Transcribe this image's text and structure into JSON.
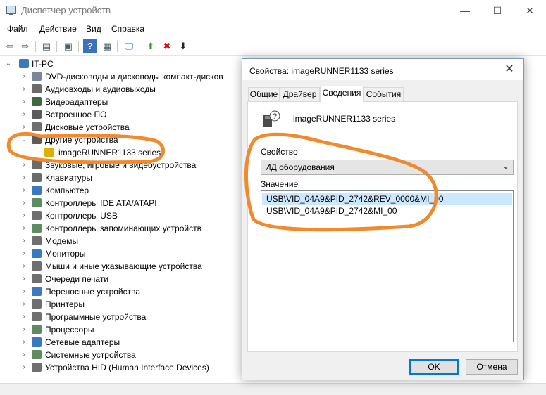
{
  "window": {
    "title": "Диспетчер устройств",
    "controls": {
      "minimize": "—",
      "maximize": "☐",
      "close": "✕"
    }
  },
  "menu": [
    "Файл",
    "Действие",
    "Вид",
    "Справка"
  ],
  "toolbar": {
    "icons": [
      "back-icon",
      "forward-icon",
      "properties-icon",
      "show-hidden-icon",
      "help-icon",
      "action-icon",
      "monitor-icon",
      "update-driver-icon",
      "uninstall-icon",
      "download-icon"
    ],
    "glyphs": [
      "⇦",
      "⇨",
      "▤",
      "▣",
      "?",
      "▦",
      "🖵",
      "⬆",
      "✖",
      "⬇"
    ]
  },
  "tree": {
    "root": "IT-PC",
    "items": [
      {
        "label": "DVD-дисководы и дисководы компакт-дисков",
        "expander": "›",
        "color": "#7a8796"
      },
      {
        "label": "Аудиовходы и аудиовыходы",
        "expander": "›",
        "color": "#6b6b6b"
      },
      {
        "label": "Видеоадаптеры",
        "expander": "›",
        "color": "#3d6b3d"
      },
      {
        "label": "Встроенное ПО",
        "expander": "›",
        "color": "#5b5b5b"
      },
      {
        "label": "Дисковые устройства",
        "expander": "›",
        "color": "#6f6f6f"
      },
      {
        "label": "Другие устройства",
        "expander": "⌄",
        "color": "#5b5b5b"
      },
      {
        "label": "imageRUNNER1133 series",
        "expander": "",
        "color": "#e0b000"
      },
      {
        "label": "Звуковые, игровые и видеоустройства",
        "expander": "›",
        "color": "#6b6b6b"
      },
      {
        "label": "Клавиатуры",
        "expander": "›",
        "color": "#6b6b6b"
      },
      {
        "label": "Компьютер",
        "expander": "›",
        "color": "#3a78c2"
      },
      {
        "label": "Контроллеры IDE ATA/ATAPI",
        "expander": "›",
        "color": "#5e8c5e"
      },
      {
        "label": "Контроллеры USB",
        "expander": "›",
        "color": "#6f6f6f"
      },
      {
        "label": "Контроллеры запоминающих устройств",
        "expander": "›",
        "color": "#5e8c5e"
      },
      {
        "label": "Модемы",
        "expander": "›",
        "color": "#6f6f6f"
      },
      {
        "label": "Мониторы",
        "expander": "›",
        "color": "#3a78c2"
      },
      {
        "label": "Мыши и иные указывающие устройства",
        "expander": "›",
        "color": "#6f6f6f"
      },
      {
        "label": "Очереди печати",
        "expander": "›",
        "color": "#6f6f6f"
      },
      {
        "label": "Переносные устройства",
        "expander": "›",
        "color": "#3a78c2"
      },
      {
        "label": "Принтеры",
        "expander": "›",
        "color": "#6f6f6f"
      },
      {
        "label": "Программные устройства",
        "expander": "›",
        "color": "#6f6f6f"
      },
      {
        "label": "Процессоры",
        "expander": "›",
        "color": "#5e8c5e"
      },
      {
        "label": "Сетевые адаптеры",
        "expander": "›",
        "color": "#3a78c2"
      },
      {
        "label": "Системные устройства",
        "expander": "›",
        "color": "#5e8c5e"
      },
      {
        "label": "Устройства HID (Human Interface Devices)",
        "expander": "›",
        "color": "#6f6f6f"
      }
    ]
  },
  "dialog": {
    "title": "Свойства: imageRUNNER1133 series",
    "close": "✕",
    "tabs": [
      "Общие",
      "Драйвер",
      "Сведения",
      "События"
    ],
    "active_tab": "Сведения",
    "device_name": "imageRUNNER1133 series",
    "property_label": "Свойство",
    "property_value": "ИД оборудования",
    "property_arrow": "⌄",
    "value_label": "Значение",
    "values": [
      "USB\\VID_04A9&PID_2742&REV_0000&MI_00",
      "USB\\VID_04A9&PID_2742&MI_00"
    ],
    "ok": "OK",
    "cancel": "Отмена"
  },
  "annotation_color": "#f08a2c"
}
